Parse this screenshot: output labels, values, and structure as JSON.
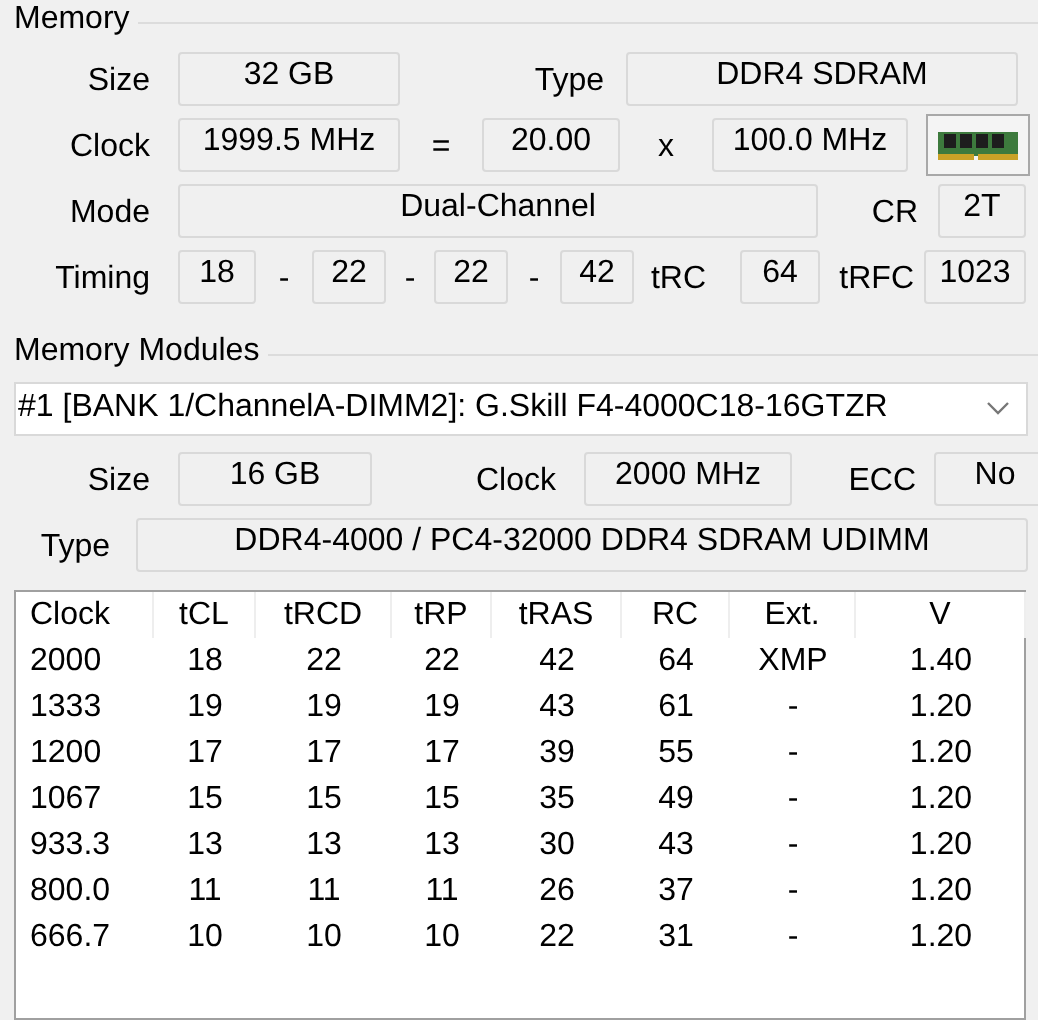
{
  "memory": {
    "title": "Memory",
    "size_label": "Size",
    "size": "32 GB",
    "type_label": "Type",
    "type": "DDR4 SDRAM",
    "clock_label": "Clock",
    "clock": "1999.5 MHz",
    "equals_sign": "=",
    "multiplier": "20.00",
    "times_sign": "x",
    "bus_clock": "100.0 MHz",
    "mode_label": "Mode",
    "mode": "Dual-Channel",
    "cr_label": "CR",
    "cr": "2T",
    "timing_label": "Timing",
    "timings": [
      "18",
      "22",
      "22",
      "42"
    ],
    "timing_separators": [
      "-",
      "-",
      "-"
    ],
    "trc_label": "tRC",
    "trc": "64",
    "trfc_label": "tRFC",
    "trfc": "1023"
  },
  "modules": {
    "title": "Memory Modules",
    "selected_module": "#1 [BANK 1/ChannelA-DIMM2]: G.Skill F4-4000C18-16GTZR",
    "size_label": "Size",
    "size": "16 GB",
    "clock_label": "Clock",
    "clock": "2000 MHz",
    "ecc_label": "ECC",
    "ecc": "No",
    "type_label": "Type",
    "type": "DDR4-4000 / PC4-32000 DDR4 SDRAM UDIMM",
    "table": {
      "columns": [
        "Clock",
        "tCL",
        "tRCD",
        "tRP",
        "tRAS",
        "RC",
        "Ext.",
        "V"
      ],
      "rows": [
        [
          "2000",
          "18",
          "22",
          "22",
          "42",
          "64",
          "XMP",
          "1.40"
        ],
        [
          "1333",
          "19",
          "19",
          "19",
          "43",
          "61",
          "-",
          "1.20"
        ],
        [
          "1200",
          "17",
          "17",
          "17",
          "39",
          "55",
          "-",
          "1.20"
        ],
        [
          "1067",
          "15",
          "15",
          "15",
          "35",
          "49",
          "-",
          "1.20"
        ],
        [
          "933.3",
          "13",
          "13",
          "13",
          "30",
          "43",
          "-",
          "1.20"
        ],
        [
          "800.0",
          "11",
          "11",
          "11",
          "26",
          "37",
          "-",
          "1.20"
        ],
        [
          "666.7",
          "10",
          "10",
          "10",
          "22",
          "31",
          "-",
          "1.20"
        ]
      ]
    }
  }
}
